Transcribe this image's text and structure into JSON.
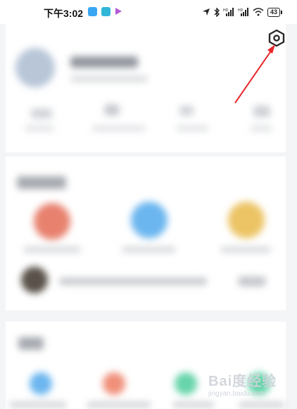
{
  "status_bar": {
    "time": "下午3:02",
    "battery": "43",
    "icons": [
      "location-icon",
      "bluetooth-icon",
      "hd-signal-icon",
      "hd-signal-icon",
      "wifi-icon",
      "battery-icon"
    ]
  },
  "header": {
    "settings_icon": "settings-hexagon-icon"
  },
  "watermark": {
    "text": "Bai度经验",
    "sub": "jingyan.baidu.com"
  },
  "colors": {
    "accent_arrow": "#e8262b",
    "circle_red": "#e8826f",
    "circle_blue": "#6cb6ef",
    "circle_yellow": "#ecc465",
    "circle_green": "#67d4ab"
  }
}
